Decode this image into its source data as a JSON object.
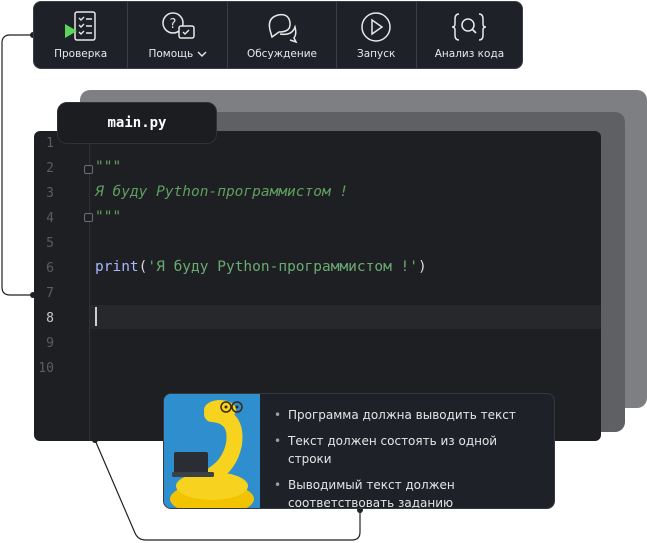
{
  "toolbar": {
    "items": [
      {
        "label": "Проверка",
        "icon": "checklist-play-icon"
      },
      {
        "label": "Помощь",
        "icon": "help-chat-icon",
        "has_dropdown": true
      },
      {
        "label": "Обсуждение",
        "icon": "discussion-bubbles-icon"
      },
      {
        "label": "Запуск",
        "icon": "play-circle-icon"
      },
      {
        "label": "Анализ кода",
        "icon": "code-search-icon"
      }
    ]
  },
  "editor": {
    "tab_title": "main.py",
    "line_numbers": [
      "1",
      "2",
      "3",
      "4",
      "5",
      "6",
      "7",
      "8",
      "9",
      "10"
    ],
    "current_line": "8",
    "code": {
      "line2": "\"\"\"",
      "line3": "Я буду Python-программистом !",
      "line4": "\"\"\"",
      "line6_fn": "print",
      "line6_open": "(",
      "line6_str": "'Я буду Python-программистом !'",
      "line6_close": ")"
    }
  },
  "task": {
    "items": [
      "Программа должна выводить текст",
      "Текст должен состоять из одной строки",
      "Выводимый текст должен соответствовать заданию"
    ]
  },
  "colors": {
    "accent_green": "#5bd65b",
    "toolbar_bg": "#1e2228",
    "editor_bg": "#1e1f22",
    "docstring": "#5f9f5f",
    "function": "#a9b7ff",
    "string": "#6aab73"
  }
}
